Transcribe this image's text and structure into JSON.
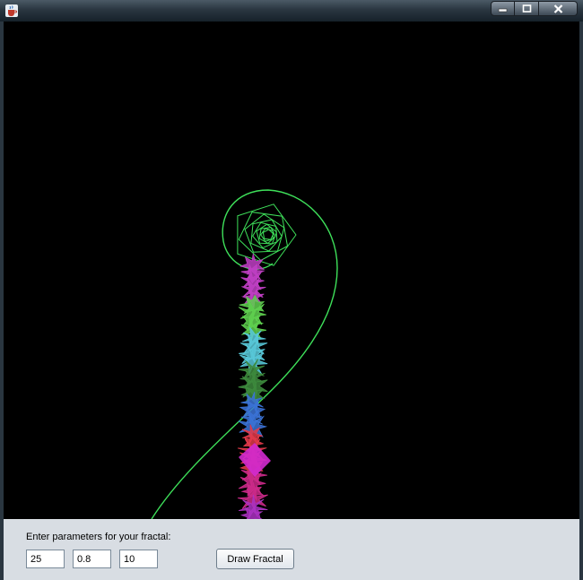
{
  "window": {
    "icon": "java-cup-icon",
    "controls": {
      "minimize_icon": "minimize-icon",
      "maximize_icon": "maximize-icon",
      "close_icon": "close-icon"
    }
  },
  "canvas": {
    "background": "#000000",
    "spiral_color": "#3ee05a",
    "stem_colors": [
      "#c03fc4",
      "#5fd04f",
      "#58c8d8",
      "#3d8a3d",
      "#3b73d6",
      "#e23a4a",
      "#cc2a8a",
      "#ab33c2"
    ]
  },
  "panel": {
    "prompt": "Enter parameters for your fractal:",
    "fields": [
      "25",
      "0.8",
      "10"
    ],
    "draw_button": "Draw Fractal"
  }
}
